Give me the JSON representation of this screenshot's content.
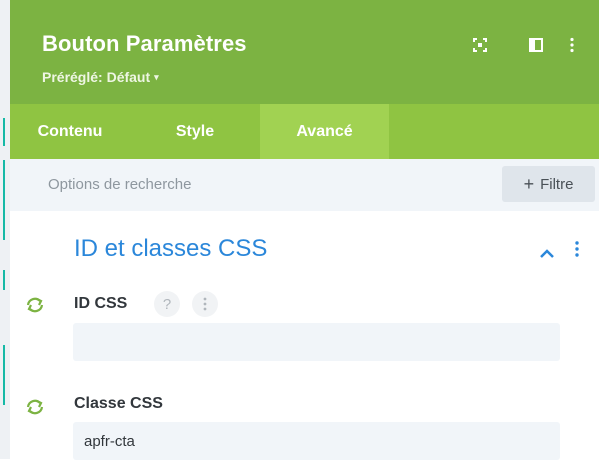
{
  "header": {
    "title": "Bouton Paramètres",
    "preset_label": "Préréglé: Défaut",
    "icons": [
      "expand-icon",
      "sidebar-toggle-icon",
      "more-vertical-icon"
    ]
  },
  "tabs": [
    {
      "label": "Contenu",
      "active": false
    },
    {
      "label": "Style",
      "active": false
    },
    {
      "label": "Avancé",
      "active": true
    }
  ],
  "search": {
    "placeholder": "Options de recherche",
    "filter_label": "Filtre"
  },
  "section": {
    "title": "ID et classes CSS",
    "expanded": true
  },
  "fields": {
    "css_id": {
      "label": "ID CSS",
      "value": "",
      "help": "?"
    },
    "css_class": {
      "label": "Classe CSS",
      "value": "apfr-cta"
    }
  },
  "colors": {
    "header": "#7cb342",
    "tabs": "#8fc442",
    "active_tab": "#a1d252",
    "section_title": "#2b87da",
    "sync_icon": "#7cb342"
  }
}
